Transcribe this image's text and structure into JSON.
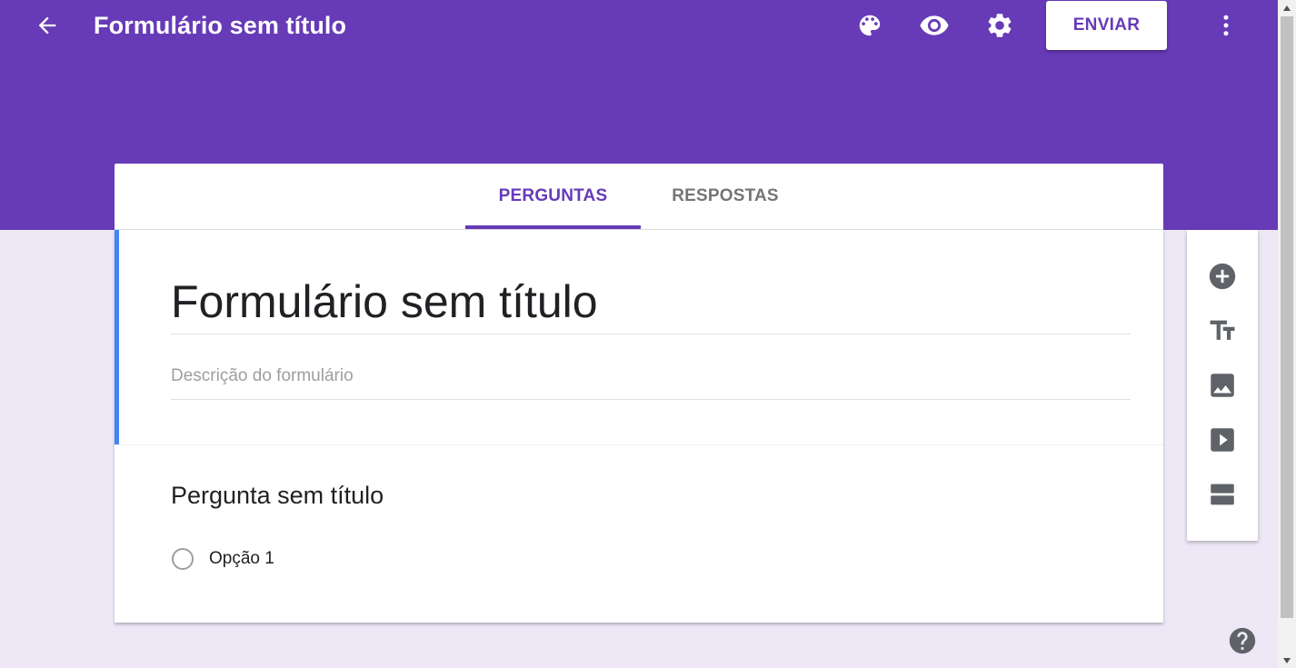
{
  "header": {
    "title": "Formulário sem título",
    "send_label": "ENVIAR",
    "icons": [
      "back-arrow-icon",
      "palette-icon",
      "eye-icon",
      "gear-icon",
      "more-vert-icon"
    ],
    "color": "#673ab7"
  },
  "tabs": [
    {
      "label": "PERGUNTAS",
      "active": true
    },
    {
      "label": "RESPOSTAS",
      "active": false
    }
  ],
  "form": {
    "title": "Formulário sem título",
    "description_placeholder": "Descrição do formulário"
  },
  "question": {
    "title": "Pergunta sem título",
    "options": [
      "Opção 1"
    ]
  },
  "toolbar": {
    "items": [
      "add-question-icon",
      "add-title-icon",
      "add-image-icon",
      "add-video-icon",
      "add-section-icon"
    ]
  },
  "colors": {
    "accent": "#673ab7",
    "background": "#ede7f6",
    "focus_bar": "#4285f4"
  }
}
